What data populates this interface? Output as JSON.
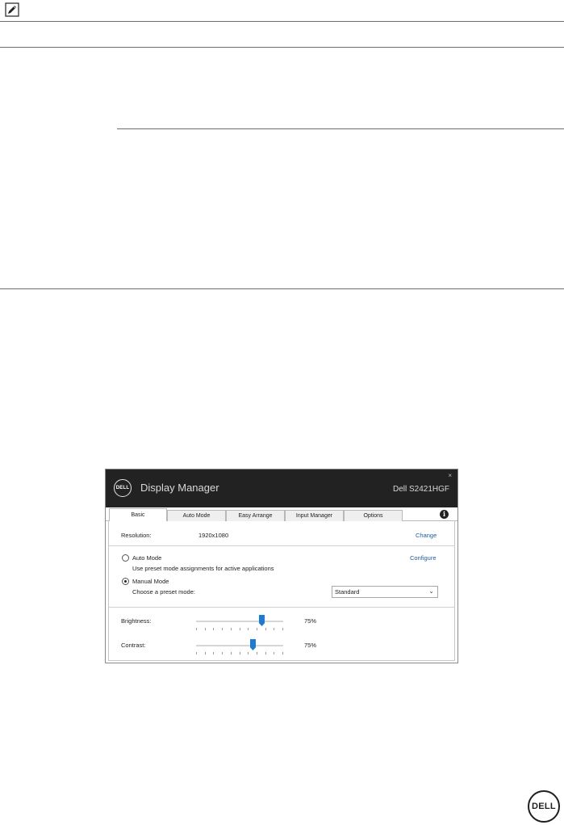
{
  "window": {
    "logo_text": "DELL",
    "title": "Display Manager",
    "model": "Dell S2421HGF",
    "close_glyph": "×"
  },
  "tabs": [
    {
      "label": "Basic",
      "active": true
    },
    {
      "label": "Auto Mode",
      "active": false
    },
    {
      "label": "Easy Arrange",
      "active": false
    },
    {
      "label": "Input Manager",
      "active": false
    },
    {
      "label": "Options",
      "active": false
    }
  ],
  "info_glyph": "i",
  "resolution": {
    "label": "Resolution:",
    "value": "1920x1080",
    "change_link": "Change"
  },
  "auto_mode": {
    "label": "Auto Mode",
    "description": "Use preset mode assignments for active applications",
    "configure_link": "Configure",
    "selected": false
  },
  "manual_mode": {
    "label": "Manual Mode",
    "description": "Choose a preset mode:",
    "selected": true,
    "preset_value": "Standard"
  },
  "brightness": {
    "label": "Brightness:",
    "value_text": "75%",
    "level": 0.75
  },
  "contrast": {
    "label": "Contrast:",
    "value_text": "75%",
    "level": 0.65
  },
  "footer_logo_text": "DELL",
  "colors": {
    "accent": "#1f7ad1",
    "titlebar": "#222222",
    "link": "#1f5da0"
  }
}
